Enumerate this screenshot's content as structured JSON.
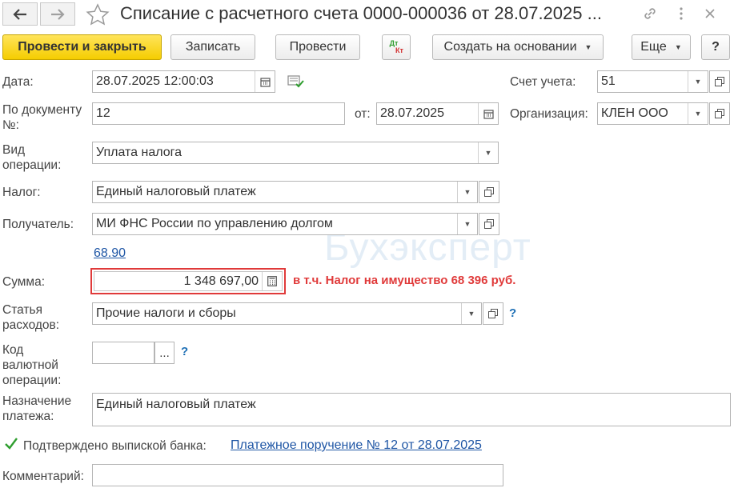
{
  "title": "Списание с расчетного счета 0000-000036 от 28.07.2025 ...",
  "toolbar": {
    "post_close": "Провести и закрыть",
    "save": "Записать",
    "post": "Провести",
    "dtkt_top": "Дт",
    "dtkt_bottom": "Кт",
    "create_based": "Создать на основании",
    "more": "Еще",
    "help": "?"
  },
  "form": {
    "date_label": "Дата:",
    "date_value": "28.07.2025 12:00:03",
    "account_label": "Счет учета:",
    "account_value": "51",
    "doc_label": "По документу №:",
    "doc_value": "12",
    "from_label": "от:",
    "from_value": "28.07.2025",
    "org_label": "Организация:",
    "org_value": "КЛЕН ООО",
    "op_label": "Вид операции:",
    "op_value": "Уплата налога",
    "tax_label": "Налог:",
    "tax_value": "Единый налоговый платеж",
    "recipient_label": "Получатель:",
    "recipient_value": "МИ ФНС России по управлению долгом",
    "recipient_link": "68.90",
    "sum_label": "Сумма:",
    "sum_value": "1 348 697,00",
    "sum_note": "в т.ч. Налог на имущество 68 396 руб.",
    "expense_label": "Статья расходов:",
    "expense_value": "Прочие налоги и сборы",
    "currency_label": "Код валютной операции:",
    "currency_value": "",
    "currency_btn": "...",
    "purpose_label": "Назначение платежа:",
    "purpose_value": "Единый налоговый платеж",
    "confirm_label": "Подтверждено выпиской банка:",
    "confirm_link": "Платежное поручение № 12 от 28.07.2025",
    "comment_label": "Комментарий:",
    "comment_value": "",
    "help_mark": "?"
  },
  "watermark": "Бухэксперт",
  "colors": {
    "primary_button": "#f5cd00",
    "sum_highlight": "#e03a3a",
    "link": "#1f56a5",
    "check": "#2f9e2f"
  }
}
